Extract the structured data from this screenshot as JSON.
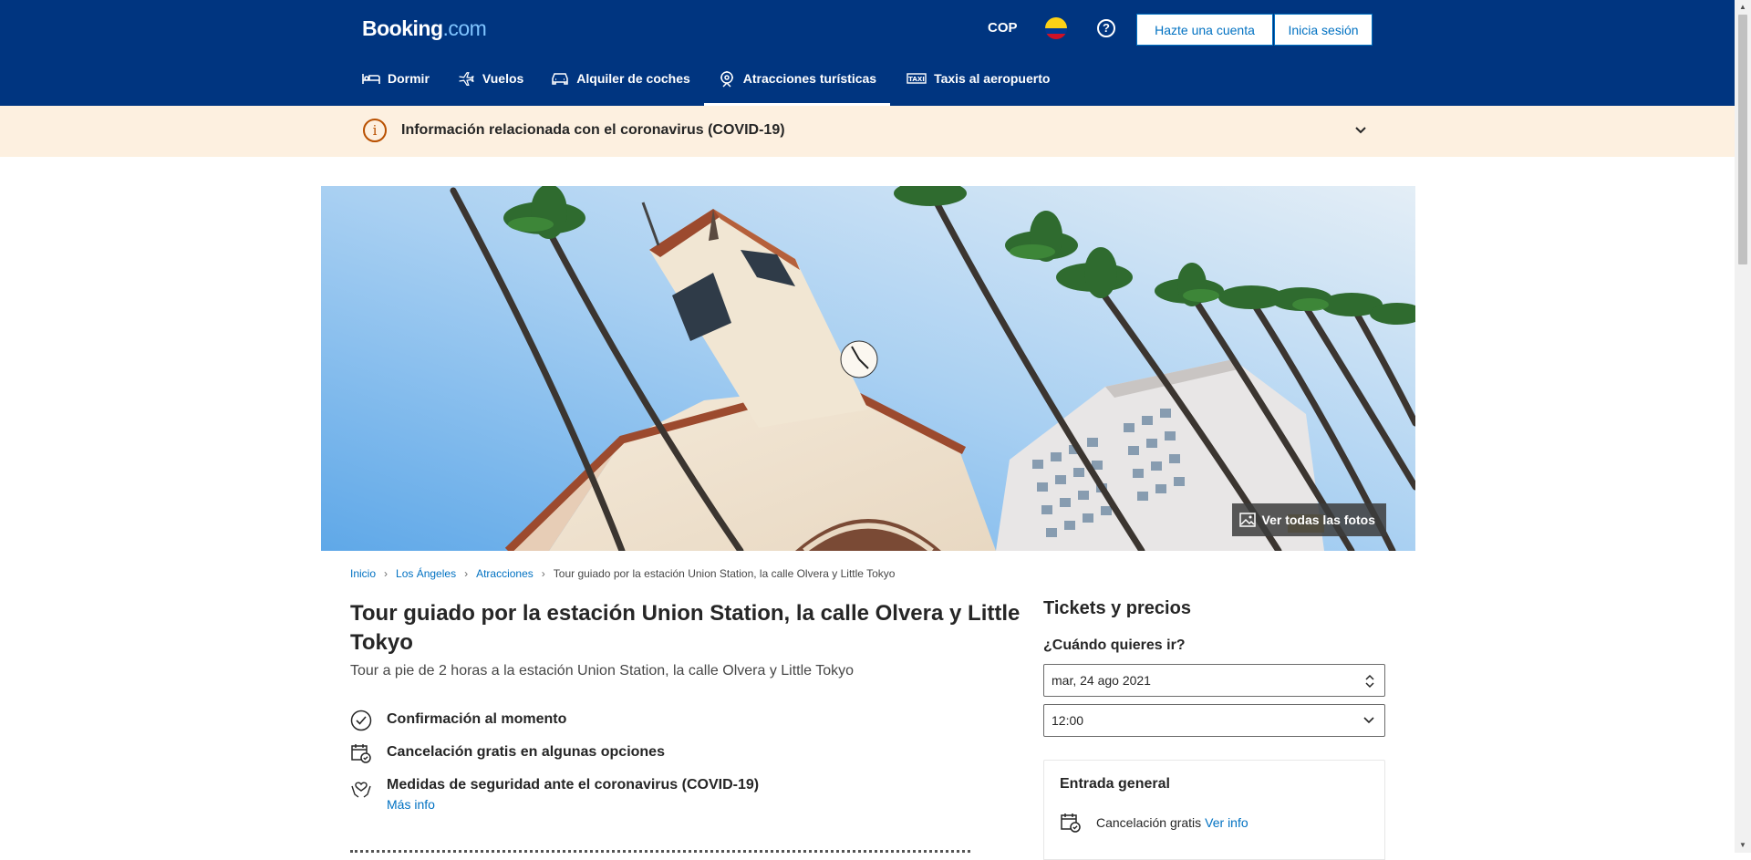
{
  "header": {
    "logo_main": "Booking",
    "logo_suffix": ".com",
    "currency": "COP",
    "help": "?",
    "register_label": "Hazte una cuenta",
    "login_label": "Inicia sesión",
    "nav": [
      {
        "label": "Dormir",
        "icon": "bed-icon"
      },
      {
        "label": "Vuelos",
        "icon": "plane-icon"
      },
      {
        "label": "Alquiler de coches",
        "icon": "car-icon"
      },
      {
        "label": "Atracciones turísticas",
        "icon": "attractions-icon",
        "active": true
      },
      {
        "label": "Taxis al aeropuerto",
        "icon": "taxi-icon"
      }
    ]
  },
  "covid_banner": {
    "icon": "i",
    "text": "Información relacionada con el coronavirus (COVID-19)"
  },
  "hero": {
    "photos_label": "Ver todas las fotos"
  },
  "breadcrumb": [
    "Inicio",
    "Los Ángeles",
    "Atracciones",
    "Tour guiado por la estación Union Station, la calle Olvera y Little Tokyo"
  ],
  "main": {
    "title": "Tour guiado por la estación Union Station, la calle Olvera y Little Tokyo",
    "subtitle": "Tour a pie de 2 horas a la estación Union Station, la calle Olvera y Little Tokyo",
    "features": [
      {
        "text": "Confirmación al momento",
        "icon": "check-circle-icon"
      },
      {
        "text": "Cancelación gratis en algunas opciones",
        "icon": "calendar-check-icon"
      },
      {
        "text": "Medidas de seguridad ante el coronavirus (COVID-19)",
        "icon": "hands-heart-icon",
        "more": "Más info"
      }
    ]
  },
  "sidebar": {
    "title": "Tickets y precios",
    "when_label": "¿Cuándo quieres ir?",
    "date_value": "mar, 24 ago 2021",
    "time_value": "12:00",
    "card": {
      "title": "Entrada general",
      "cancel_text": "Cancelación gratis",
      "cancel_link": "Ver info"
    }
  },
  "colors": {
    "brand_blue": "#003580",
    "link_blue": "#0071c2",
    "covid_bg": "#fdf0e0",
    "covid_accent": "#b95000"
  }
}
